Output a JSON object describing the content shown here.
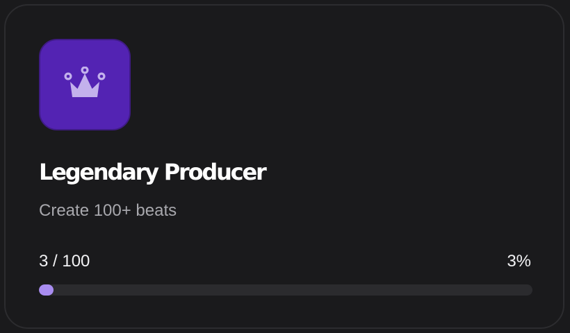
{
  "achievement": {
    "icon": "crown-icon",
    "title": "Legendary Producer",
    "description": "Create 100+ beats",
    "progress": {
      "current": 3,
      "target": 100,
      "count_text": "3 / 100",
      "percent_text": "3%",
      "fraction": 0.03
    }
  },
  "colors": {
    "badge_background": "#5323b3",
    "icon": "#c3b1ec",
    "progress_fill": "#a88cf0",
    "progress_track": "#2b2b2e",
    "card_background": "#1a1a1c"
  }
}
